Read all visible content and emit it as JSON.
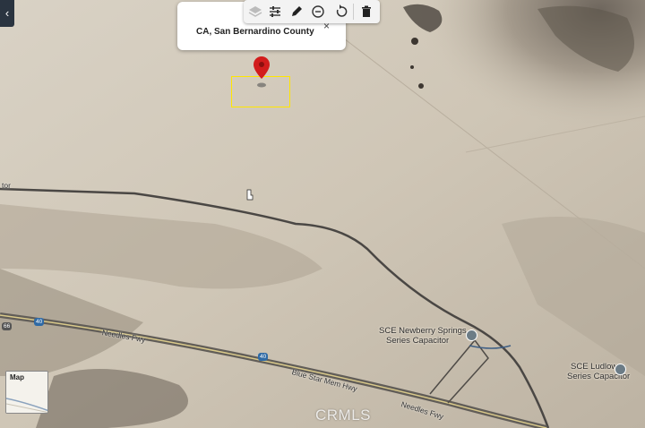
{
  "nav": {
    "back_glyph": "‹"
  },
  "popup": {
    "title": "CA, San Bernardino County",
    "close_glyph": "×"
  },
  "toolbar": {
    "tools": [
      "layers-icon",
      "settings-sliders-icon",
      "pencil-icon",
      "measure-icon",
      "undo-icon",
      "trash-icon"
    ]
  },
  "map": {
    "places": [
      {
        "name": "SCE Newberry Springs",
        "sub": "Series Capacitor"
      },
      {
        "name": "SCE Ludlow",
        "sub": "Series Capacitor"
      }
    ],
    "roads": {
      "needles_fwy_1": "Needles Fwy",
      "needles_fwy_2": "Needles Fwy",
      "blue_star": "Blue Star Mem Hwy",
      "partial": "tor"
    },
    "shields": {
      "i40_a": "40",
      "i40_b": "40",
      "route_66": "66"
    },
    "colors": {
      "parcel": "#ffe600",
      "pin": "#d21c1c"
    }
  },
  "minimap": {
    "label": "Map"
  },
  "watermark": "CRMLS"
}
